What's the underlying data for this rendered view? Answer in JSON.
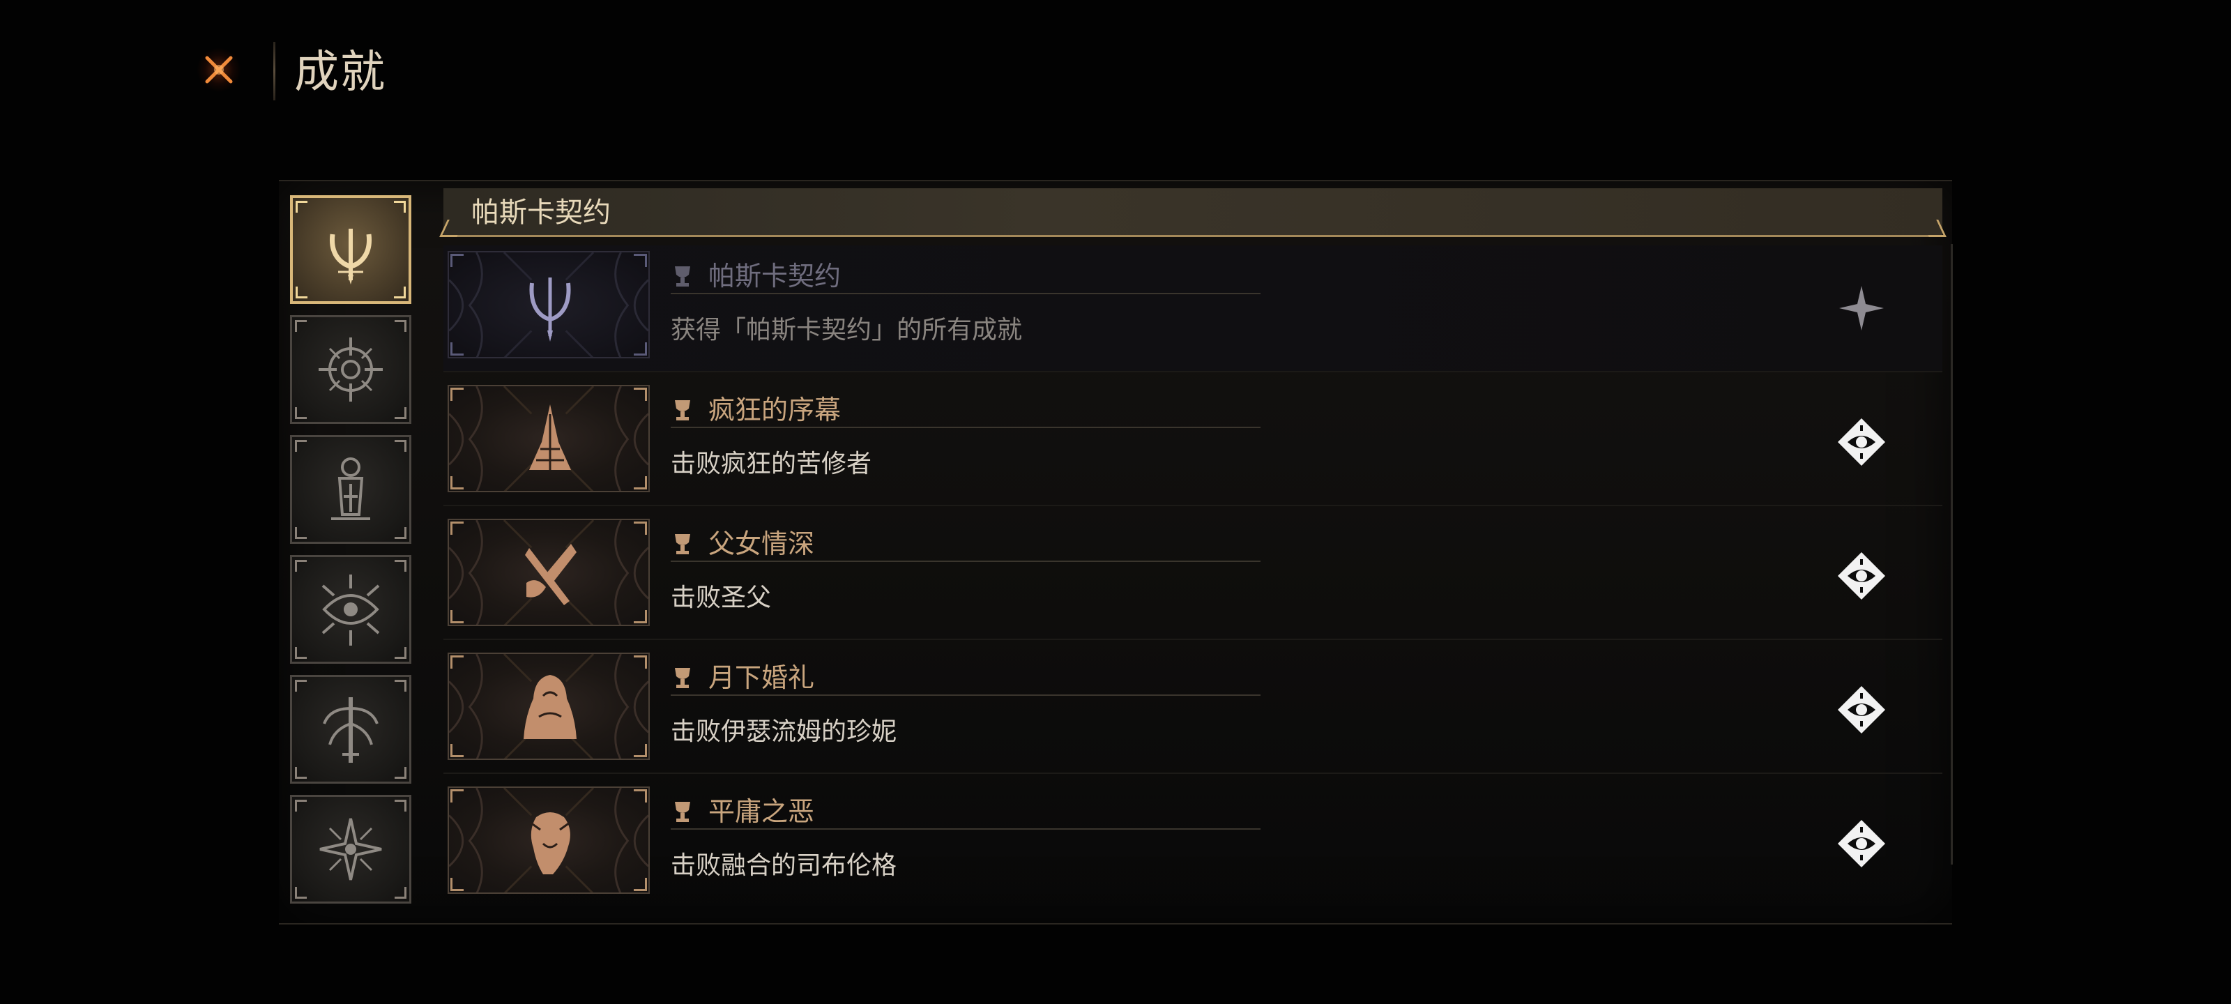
{
  "header": {
    "title": "成就",
    "close_icon": "close-x-icon"
  },
  "categories": [
    {
      "id": "pascal-contract",
      "icon": "tuning-fork-emblem-icon",
      "active": true
    },
    {
      "id": "category-2",
      "icon": "crosshair-eye-emblem-icon",
      "active": false
    },
    {
      "id": "category-3",
      "icon": "lantern-emblem-icon",
      "active": false
    },
    {
      "id": "category-4",
      "icon": "thorn-eye-emblem-icon",
      "active": false
    },
    {
      "id": "category-5",
      "icon": "tentacle-emblem-icon",
      "active": false
    },
    {
      "id": "category-6",
      "icon": "star-sigil-emblem-icon",
      "active": false
    }
  ],
  "section": {
    "title": "帕斯卡契约"
  },
  "achievements": [
    {
      "name": "帕斯卡契约",
      "description": "获得「帕斯卡契约」的所有成就",
      "status_icon": "sparkle-star-icon",
      "emblem": "tuning-fork-emblem",
      "completed": true
    },
    {
      "name": "疯狂的序幕",
      "description": "击败疯狂的苦修者",
      "status_icon": "diamond-eye-badge-icon",
      "emblem": "spire-emblem",
      "completed": false
    },
    {
      "name": "父女情深",
      "description": "击败圣父",
      "status_icon": "diamond-eye-badge-icon",
      "emblem": "blade-emblem",
      "completed": false
    },
    {
      "name": "月下婚礼",
      "description": "击败伊瑟流姆的珍妮",
      "status_icon": "diamond-eye-badge-icon",
      "emblem": "veiled-bride-emblem",
      "completed": false
    },
    {
      "name": "平庸之恶",
      "description": "击败融合的司布伦格",
      "status_icon": "diamond-eye-badge-icon",
      "emblem": "beast-emblem",
      "completed": false
    }
  ],
  "colors": {
    "accent_gold": "#d8b779",
    "achievement_title": "#c9a57e",
    "completed_title": "#6f6d7e",
    "close_orange": "#f07a32"
  }
}
